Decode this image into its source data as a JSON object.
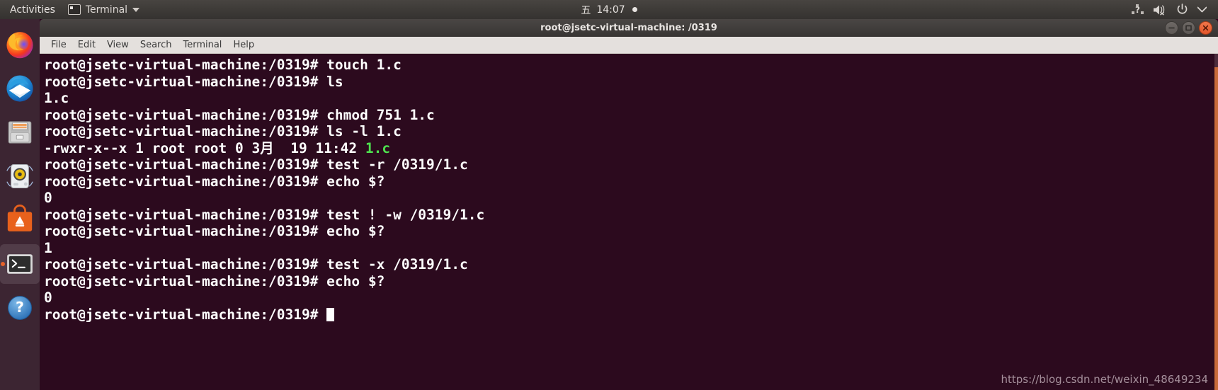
{
  "topbar": {
    "activities_label": "Activities",
    "app_menu_label": "Terminal",
    "app_menu_icon": "terminal-icon",
    "clock": {
      "weekday": "五",
      "time": "14:07",
      "notification_dot": true
    },
    "tray_icons": [
      {
        "name": "input-method-icon",
        "label": "?"
      },
      {
        "name": "volume-muted-icon",
        "label": ""
      },
      {
        "name": "power-icon",
        "label": ""
      },
      {
        "name": "system-menu-caret-icon",
        "label": ""
      }
    ]
  },
  "dock": {
    "items": [
      {
        "name": "dock-item-firefox",
        "label": "Firefox",
        "active": false
      },
      {
        "name": "dock-item-thunderbird",
        "label": "Thunderbird Mail",
        "active": false
      },
      {
        "name": "dock-item-files",
        "label": "Files",
        "active": false
      },
      {
        "name": "dock-item-rhythmbox",
        "label": "Rhythmbox",
        "active": false
      },
      {
        "name": "dock-item-ubuntu-software",
        "label": "Ubuntu Software",
        "active": false
      },
      {
        "name": "dock-item-terminal",
        "label": "Terminal",
        "active": true
      },
      {
        "name": "dock-item-help",
        "label": "Help",
        "active": false
      }
    ]
  },
  "window": {
    "title": "root@jsetc-virtual-machine: /0319",
    "buttons": [
      {
        "name": "minimize-button",
        "glyph": "minimize"
      },
      {
        "name": "maximize-button",
        "glyph": "maximize"
      },
      {
        "name": "close-button",
        "glyph": "close"
      }
    ],
    "menu": [
      {
        "label": "File"
      },
      {
        "label": "Edit"
      },
      {
        "label": "View"
      },
      {
        "label": "Search"
      },
      {
        "label": "Terminal"
      },
      {
        "label": "Help"
      }
    ]
  },
  "terminal": {
    "prompt": "root@jsetc-virtual-machine:/0319# ",
    "background_color": "#2c0a1e",
    "text_color": "#ffffff",
    "green_color": "#4ee24e",
    "lines": [
      {
        "prompt": true,
        "text": "touch 1.c"
      },
      {
        "prompt": true,
        "text": "ls"
      },
      {
        "prompt": false,
        "text": "1.c"
      },
      {
        "prompt": true,
        "text": "chmod 751 1.c"
      },
      {
        "prompt": true,
        "text": "ls -l 1.c"
      },
      {
        "prompt": false,
        "text": "-rwxr-x--x 1 root root 0 3月  19 11:42 ",
        "green_suffix": "1.c"
      },
      {
        "prompt": true,
        "text": "test -r /0319/1.c"
      },
      {
        "prompt": true,
        "text": "echo $?"
      },
      {
        "prompt": false,
        "text": "0"
      },
      {
        "prompt": true,
        "text": "test ! -w /0319/1.c"
      },
      {
        "prompt": true,
        "text": "echo $?"
      },
      {
        "prompt": false,
        "text": "1"
      },
      {
        "prompt": true,
        "text": "test -x /0319/1.c"
      },
      {
        "prompt": true,
        "text": "echo $?"
      },
      {
        "prompt": false,
        "text": "0"
      },
      {
        "prompt": true,
        "text": "",
        "cursor": true
      }
    ]
  },
  "watermark": {
    "text": "https://blog.csdn.net/weixin_48649234"
  }
}
